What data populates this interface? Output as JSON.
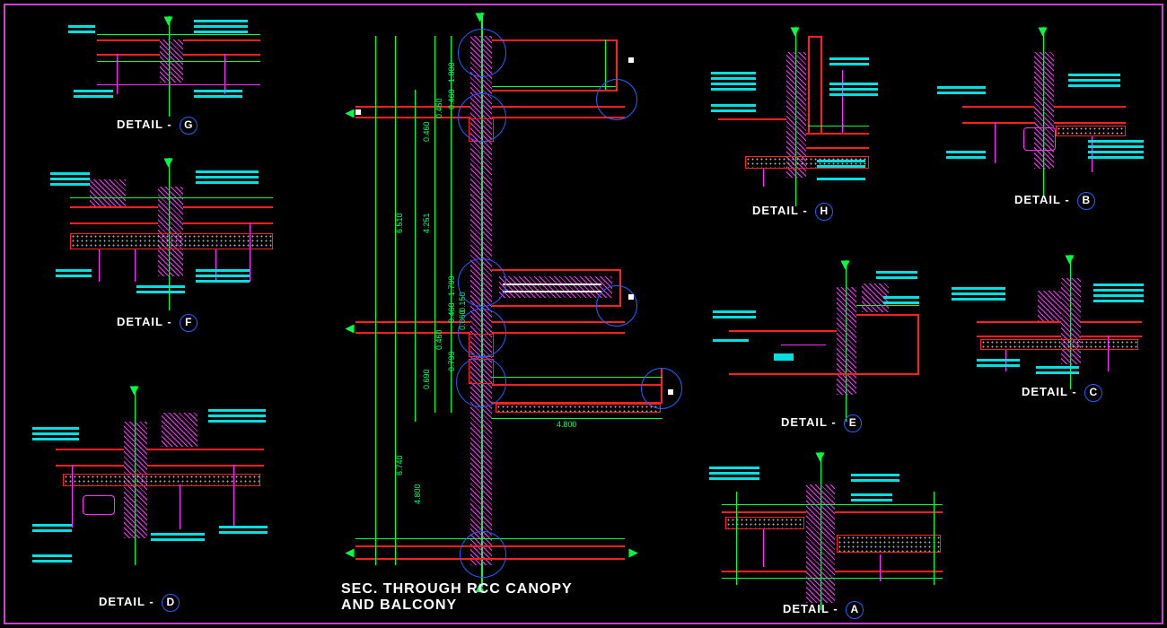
{
  "main_title_line1": "SEC. THROUGH RCC CANOPY",
  "main_title_line2": "AND BALCONY",
  "label_prefix": "DETAIL -",
  "details": {
    "a": "A",
    "b": "B",
    "c": "C",
    "d": "D",
    "e": "E",
    "f": "F",
    "g": "G",
    "h": "H"
  },
  "dims": {
    "d1": "1.800",
    "d2": "0.460",
    "d3": "0.460",
    "d4": "0.460",
    "d5": "4.251",
    "d6": "6.510",
    "d7": "1.799",
    "d8": "0.460",
    "d9": "0.150",
    "d10": "0.060",
    "d11": "0.460",
    "d12": "0.799",
    "d13": "0.690",
    "d14": "6.740",
    "d15": "4.800",
    "d16": "4.800"
  },
  "colors": {
    "frame": "#d040d0",
    "red": "#ff2020",
    "magenta": "#ff30ff",
    "green": "#00ff40",
    "cyan": "#00e0e0",
    "blue": "#2060ff",
    "white": "#ffffff"
  }
}
